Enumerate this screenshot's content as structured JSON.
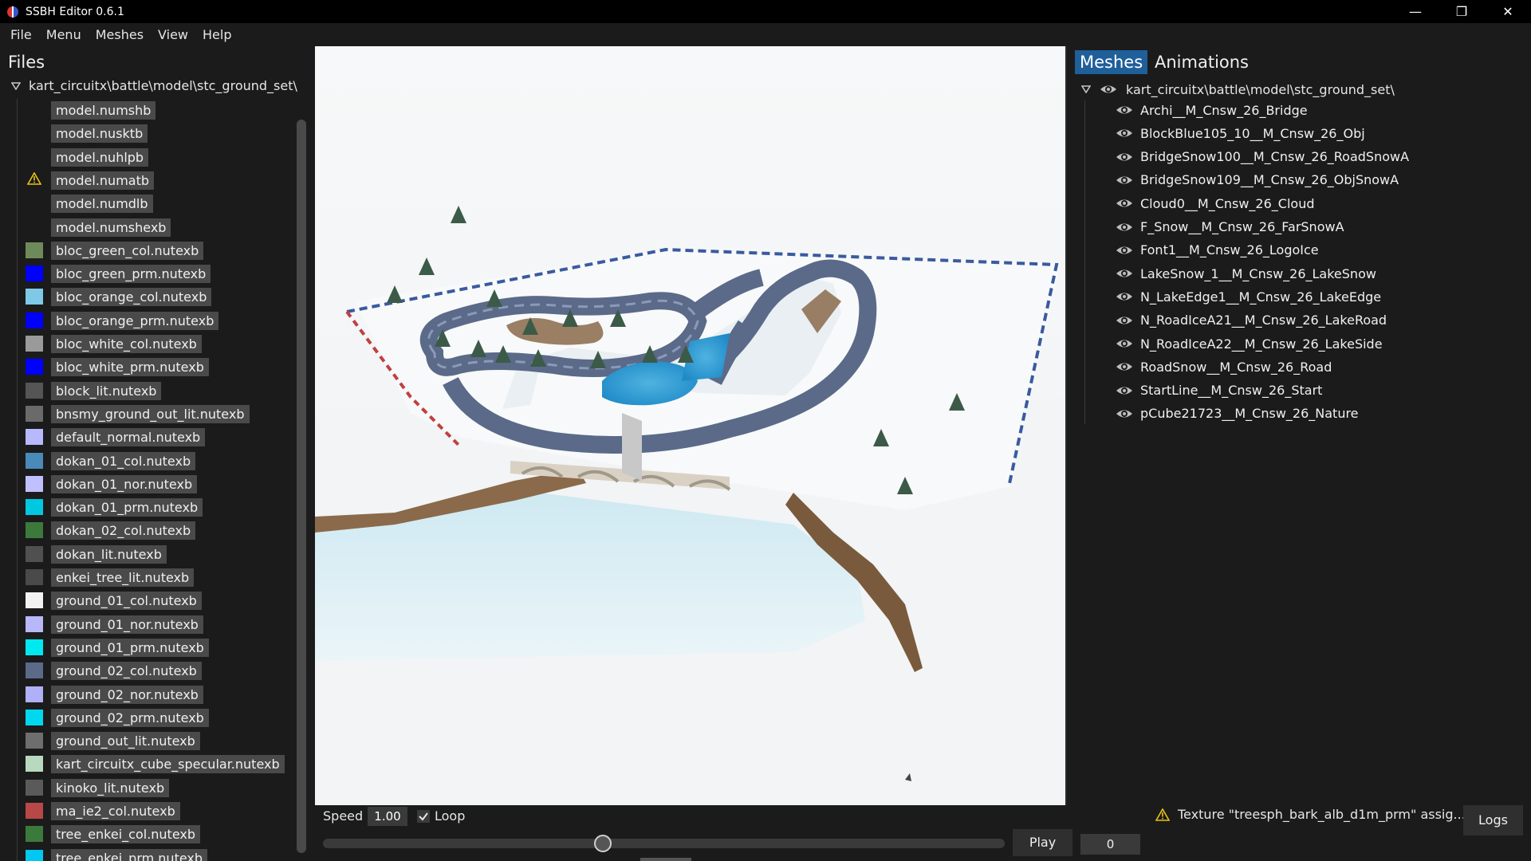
{
  "window": {
    "title": "SSBH Editor 0.6.1",
    "minimize_glyph": "—",
    "restore_glyph": "❐",
    "close_glyph": "✕"
  },
  "menu": [
    "File",
    "Menu",
    "Meshes",
    "View",
    "Help"
  ],
  "files_panel": {
    "heading": "Files",
    "root": "kart_circuitx\\battle\\model\\stc_ground_set\\",
    "files": [
      {
        "name": "model.numshb",
        "thumb": "none"
      },
      {
        "name": "model.nusktb",
        "thumb": "none"
      },
      {
        "name": "model.nuhlpb",
        "thumb": "none"
      },
      {
        "name": "model.numatb",
        "thumb": "warning-icon"
      },
      {
        "name": "model.numdlb",
        "thumb": "none"
      },
      {
        "name": "model.numshexb",
        "thumb": "none"
      },
      {
        "name": "bloc_green_col.nutexb",
        "thumb": "#6f8a5a"
      },
      {
        "name": "bloc_green_prm.nutexb",
        "thumb": "#0000ff"
      },
      {
        "name": "bloc_orange_col.nutexb",
        "thumb": "#7fc8e8"
      },
      {
        "name": "bloc_orange_prm.nutexb",
        "thumb": "#0000ff"
      },
      {
        "name": "bloc_white_col.nutexb",
        "thumb": "#9a9a9a"
      },
      {
        "name": "bloc_white_prm.nutexb",
        "thumb": "#0000ff"
      },
      {
        "name": "block_lit.nutexb",
        "thumb": "#555555"
      },
      {
        "name": "bnsmy_ground_out_lit.nutexb",
        "thumb": "#6a6a6a"
      },
      {
        "name": "default_normal.nutexb",
        "thumb": "#b8b8ff"
      },
      {
        "name": "dokan_01_col.nutexb",
        "thumb": "#4a8ab8"
      },
      {
        "name": "dokan_01_nor.nutexb",
        "thumb": "#c0c0ff"
      },
      {
        "name": "dokan_01_prm.nutexb",
        "thumb": "#00c8e0"
      },
      {
        "name": "dokan_02_col.nutexb",
        "thumb": "#3c7a3c"
      },
      {
        "name": "dokan_lit.nutexb",
        "thumb": "#505050"
      },
      {
        "name": "enkei_tree_lit.nutexb",
        "thumb": "#4a4a4a"
      },
      {
        "name": "ground_01_col.nutexb",
        "thumb": "#f2f2f2"
      },
      {
        "name": "ground_01_nor.nutexb",
        "thumb": "#b8b8f8"
      },
      {
        "name": "ground_01_prm.nutexb",
        "thumb": "#00e8f0"
      },
      {
        "name": "ground_02_col.nutexb",
        "thumb": "#5a6a88"
      },
      {
        "name": "ground_02_nor.nutexb",
        "thumb": "#b0b0f8"
      },
      {
        "name": "ground_02_prm.nutexb",
        "thumb": "#00d8f0"
      },
      {
        "name": "ground_out_lit.nutexb",
        "thumb": "#6e6e6e"
      },
      {
        "name": "kart_circuitx_cube_specular.nutexb",
        "thumb": "#b8d8c0"
      },
      {
        "name": "kinoko_lit.nutexb",
        "thumb": "#5a5a5a"
      },
      {
        "name": "ma_ie2_col.nutexb",
        "thumb": "#b84848"
      },
      {
        "name": "tree_enkei_col.nutexb",
        "thumb": "#3c7a3c"
      },
      {
        "name": "tree_enkei_prm.nutexb",
        "thumb": "#00c8f0"
      }
    ]
  },
  "meshes_panel": {
    "tabs": [
      "Meshes",
      "Animations"
    ],
    "root": "kart_circuitx\\battle\\model\\stc_ground_set\\",
    "meshes": [
      "Archi__M_Cnsw_26_Bridge",
      "BlockBlue105_10__M_Cnsw_26_Obj",
      "BridgeSnow100__M_Cnsw_26_RoadSnowA",
      "BridgeSnow109__M_Cnsw_26_ObjSnowA",
      "Cloud0__M_Cnsw_26_Cloud",
      "F_Snow__M_Cnsw_26_FarSnowA",
      "Font1__M_Cnsw_26_LogoIce",
      "LakeSnow_1__M_Cnsw_26_LakeSnow",
      "N_LakeEdge1__M_Cnsw_26_LakeEdge",
      "N_RoadIceA21__M_Cnsw_26_LakeRoad",
      "N_RoadIceA22__M_Cnsw_26_LakeSide",
      "RoadSnow__M_Cnsw_26_Road",
      "StartLine__M_Cnsw_26_Start",
      "pCube21723__M_Cnsw_26_Nature"
    ]
  },
  "bottom": {
    "speed_label": "Speed",
    "speed_value": "1.00",
    "loop_label": "Loop",
    "loop_checked": true,
    "status_text": "Texture \"treesph_bark_alb_d1m_prm\" assig...",
    "logs_label": "Logs",
    "play_label": "Play",
    "frame_value": "0",
    "timeline_position": 0.41
  },
  "colors": {
    "accent": "#1f5f9a",
    "warning": "#e8c21a"
  }
}
